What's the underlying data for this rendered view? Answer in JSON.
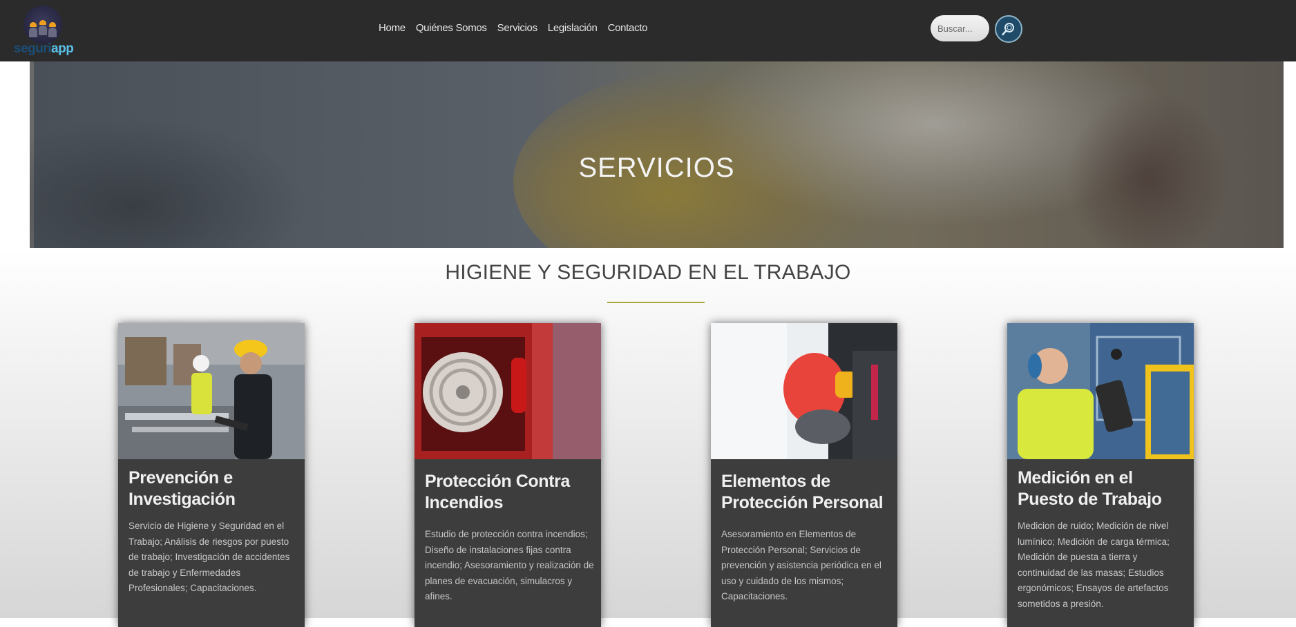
{
  "brand": {
    "logo_part1": "seguri",
    "logo_part2": "app"
  },
  "nav": {
    "items": [
      {
        "label": "Home"
      },
      {
        "label": "Quiénes Somos"
      },
      {
        "label": "Servicios"
      },
      {
        "label": "Legislación"
      },
      {
        "label": "Contacto"
      }
    ]
  },
  "search": {
    "placeholder": "Buscar..."
  },
  "hero": {
    "title": "SERVICIOS"
  },
  "section": {
    "title": "HIGIENE Y SEGURIDAD EN EL TRABAJO"
  },
  "cards": [
    {
      "title": "Prevención e Investigación",
      "text": "Servicio de Higiene y Seguridad en el Trabajo; Análisis de riesgos por puesto de trabajo; Investigación de accidentes de trabajo y Enfermedades Profesionales; Capacitaciones."
    },
    {
      "title": "Protección Contra Incendios",
      "text": "Estudio de protección contra incendios; Diseño de instalaciones fijas contra incendio; Asesoramiento y realización de planes de evacuación, simulacros y afines."
    },
    {
      "title": "Elementos de Protección Personal",
      "text": "Asesoramiento en Elementos de Protección Personal; Servicios de prevención y asistencia periódica en el uso y cuidado de los mismos; Capacitaciones."
    },
    {
      "title": "Medición en el Puesto de Trabajo",
      "text": "Medicion de ruido; Medición de nivel lumínico; Medición de carga térmica; Medición de puesta a tierra y continuidad de las masas; Estudios ergonómicos; Ensayos de artefactos sometidos a presión."
    }
  ],
  "colors": {
    "navbar": "#2b2b2b",
    "accent_underline": "#a9a63a",
    "card_bg": "#3d3d3d"
  },
  "icons": {
    "search": "magnifier-icon"
  }
}
